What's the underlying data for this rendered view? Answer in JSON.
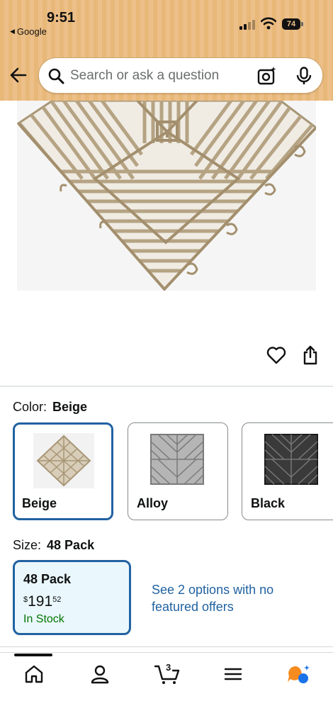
{
  "status_bar": {
    "time": "9:51",
    "back_app": "Google",
    "battery": "74"
  },
  "search": {
    "placeholder": "Search or ask a question"
  },
  "carousel": {
    "dot_count": 3,
    "active_index": 0
  },
  "color_selector": {
    "label": "Color:",
    "selected": "Beige",
    "options": [
      {
        "name": "Beige",
        "swatch": "#b9a78b"
      },
      {
        "name": "Alloy",
        "swatch": "#8c8c8c"
      },
      {
        "name": "Black",
        "swatch": "#333333"
      }
    ]
  },
  "size_selector": {
    "label": "Size:",
    "selected": "48 Pack",
    "option": {
      "name": "48 Pack",
      "price_currency": "$",
      "price_whole": "191",
      "price_fraction": "52",
      "stock": "In Stock"
    },
    "see_options_text": "See 2 options with no featured offers"
  },
  "bottom_nav": {
    "cart_count": "3",
    "items": [
      "home-icon",
      "account-icon",
      "cart-icon",
      "menu-icon",
      "rufus-icon"
    ]
  },
  "colors": {
    "header_bg": "#e8b879",
    "link_blue": "#2162a1",
    "selected_border": "#2162a1",
    "stock_green": "#007600",
    "size_bg": "#eaf7fd"
  }
}
